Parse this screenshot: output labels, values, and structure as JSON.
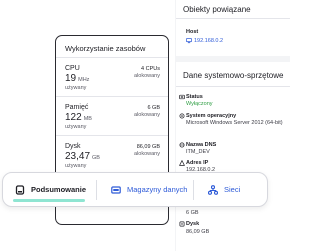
{
  "related_objects": {
    "title": "Obiekty powiązane",
    "host_label": "Host",
    "host_value": "192.168.0.2"
  },
  "system_data": {
    "title": "Dane systemowo-sprzętowe",
    "status_label": "Status",
    "status_value": "Wyłączony",
    "os_label": "System operacyjny",
    "os_value": "Microsoft Windows Server 2012 (64-bit)",
    "dns_label": "Nazwa DNS",
    "dns_value": "ITM_DEV",
    "ip_label": "Adres IP",
    "ip_value": "192.168.0.2",
    "partial_value": "6 GB",
    "disk_label": "Dysk",
    "disk_value": "86,09 GB"
  },
  "resources": {
    "title": "Wykorzystanie zasobów",
    "items": [
      {
        "name": "CPU",
        "value": "19",
        "unit": "MHz",
        "sub": "używany",
        "right": "4 CPUs",
        "right_sub": "alokowany"
      },
      {
        "name": "Pamięć",
        "value": "122",
        "unit": "MB",
        "sub": "używany",
        "right": "6 GB",
        "right_sub": "alokowany"
      },
      {
        "name": "Dysk",
        "value": "23,47",
        "unit": "GB",
        "sub": "używany",
        "right": "86,09 GB",
        "right_sub": "alokowany"
      }
    ]
  },
  "tabs": [
    {
      "label": "Podsumowanie",
      "icon": "server-icon",
      "active": true
    },
    {
      "label": "Magazyny danych",
      "icon": "datastore-icon",
      "active": false
    },
    {
      "label": "Sieci",
      "icon": "network-icon",
      "active": false
    }
  ],
  "colors": {
    "accent_blue": "#2e5bd8",
    "active_underline": "#8fe5d2",
    "status_off_green": "#2f9e44"
  }
}
